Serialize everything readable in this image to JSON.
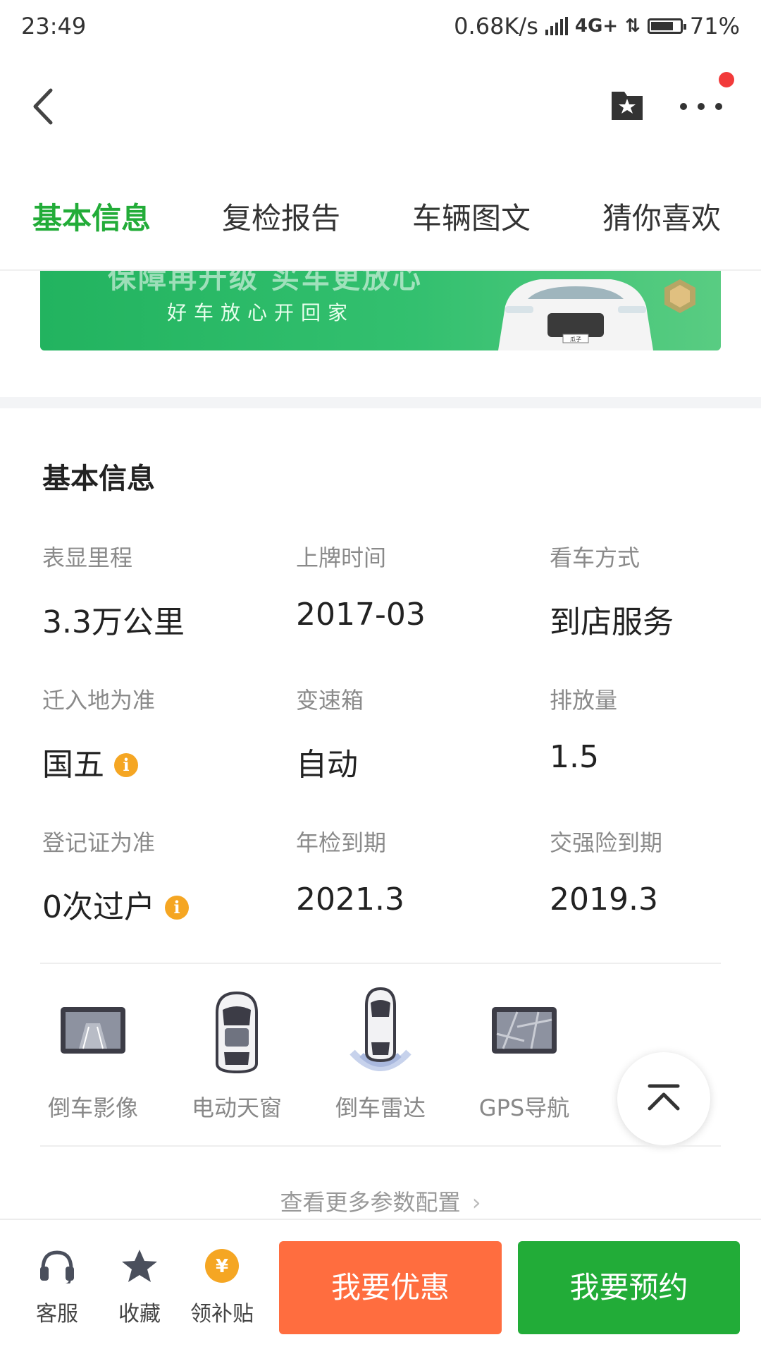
{
  "status_bar": {
    "time": "23:49",
    "network_speed": "0.68K/s",
    "network_type": "4G+",
    "battery": "71%",
    "battery_level": 0.71
  },
  "nav": {
    "back_icon": "chevron-left-icon",
    "favorite_icon": "bookmark-star-icon",
    "more_icon": "more-dots-icon",
    "has_notification": true
  },
  "tabs": [
    {
      "label": "基本信息",
      "active": true
    },
    {
      "label": "复检报告",
      "active": false
    },
    {
      "label": "车辆图文",
      "active": false
    },
    {
      "label": "猜你喜欢",
      "active": false
    }
  ],
  "banner": {
    "line1": "保障再升级 买车更放心",
    "line2": "好车放心开回家",
    "car_plate": "瓜子"
  },
  "basic_info": {
    "title": "基本信息",
    "rows": [
      [
        {
          "label": "表显里程",
          "value": "3.3万公里"
        },
        {
          "label": "上牌时间",
          "value": "2017-03"
        },
        {
          "label": "看车方式",
          "value": "到店服务"
        }
      ],
      [
        {
          "label": "迁入地为准",
          "value": "国五",
          "info": "i"
        },
        {
          "label": "变速箱",
          "value": "自动"
        },
        {
          "label": "排放量",
          "value": "1.5"
        }
      ],
      [
        {
          "label": "登记证为准",
          "value": "0次过户",
          "info": "i"
        },
        {
          "label": "年检到期",
          "value": "2021.3"
        },
        {
          "label": "交强险到期",
          "value": "2019.3"
        }
      ]
    ]
  },
  "features": [
    {
      "label": "倒车影像",
      "icon": "reverse-camera-icon"
    },
    {
      "label": "电动天窗",
      "icon": "sunroof-icon"
    },
    {
      "label": "倒车雷达",
      "icon": "parking-radar-icon"
    },
    {
      "label": "GPS导航",
      "icon": "gps-navigation-icon"
    }
  ],
  "more_config": "查看更多参数配置",
  "back_to_top_icon": "back-to-top-icon",
  "bottom_bar": {
    "service": {
      "label": "客服",
      "icon": "headset-icon"
    },
    "collect": {
      "label": "收藏",
      "icon": "star-icon"
    },
    "subsidy": {
      "label": "领补贴",
      "icon": "yen-coin-icon",
      "icon_text": "¥"
    },
    "discount_button": "我要优惠",
    "book_button": "我要预约"
  },
  "colors": {
    "accent_green": "#22ac38",
    "discount_orange": "#ff6d3f",
    "info_orange": "#f5a623",
    "notification_red": "#f23a3a"
  }
}
